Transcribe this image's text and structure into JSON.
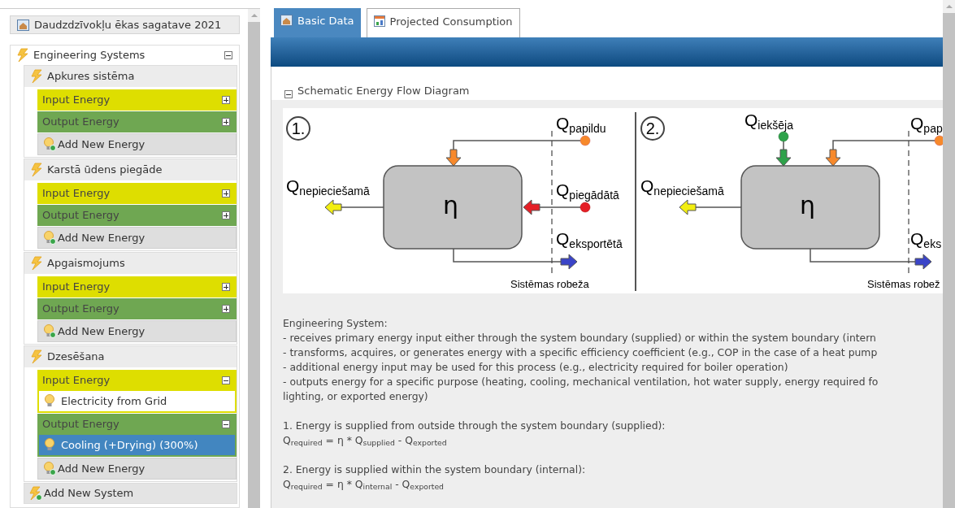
{
  "sidebar": {
    "project_button": "Daudzdzīvokļu ēkas sagatave 2021",
    "group": {
      "title": "Engineering Systems",
      "expanded": true,
      "systems": [
        {
          "name": "Apkures sistēma",
          "sections": [
            {
              "kind": "input",
              "label": "Input Energy",
              "expanded": false
            },
            {
              "kind": "output",
              "label": "Output Energy",
              "expanded": false
            }
          ],
          "add_label": "Add New Energy"
        },
        {
          "name": "Karstā ūdens piegāde",
          "sections": [
            {
              "kind": "input",
              "label": "Input Energy",
              "expanded": false
            },
            {
              "kind": "output",
              "label": "Output Energy",
              "expanded": false
            }
          ],
          "add_label": "Add New Energy"
        },
        {
          "name": "Apgaismojums",
          "sections": [
            {
              "kind": "input",
              "label": "Input Energy",
              "expanded": false
            },
            {
              "kind": "output",
              "label": "Output Energy",
              "expanded": false
            }
          ],
          "add_label": "Add New Energy"
        },
        {
          "name": "Dzesēšana",
          "sections": [
            {
              "kind": "input",
              "label": "Input Energy",
              "expanded": true,
              "items": [
                {
                  "label": "Electricity from Grid",
                  "selected": false
                }
              ]
            },
            {
              "kind": "output",
              "label": "Output Energy",
              "expanded": true,
              "items": [
                {
                  "label": "Cooling (+Drying) (300%)",
                  "selected": true
                }
              ]
            }
          ],
          "add_label": "Add New Energy"
        }
      ],
      "add_system": "Add New System"
    }
  },
  "tabs": [
    {
      "label": "Basic Data",
      "selected": true
    },
    {
      "label": "Projected Consumption",
      "selected": false
    }
  ],
  "section": {
    "title": "Schematic Energy Flow Diagram",
    "expanded": true
  },
  "diagram": {
    "panels": [
      {
        "number": "1.",
        "eta": "η",
        "labels": [
          {
            "kind": "additional",
            "text": "Q$_{papildu}$"
          },
          {
            "kind": "required",
            "text": "Q$_{nepieciešamā}$"
          },
          {
            "kind": "supplied",
            "text": "Q$_{piegādātā}$"
          },
          {
            "kind": "exported",
            "text": "Q$_{eksportētā}$"
          },
          {
            "kind": "boundary",
            "text": "Sistēmas robeža"
          }
        ]
      },
      {
        "number": "2.",
        "eta": "η",
        "labels": [
          {
            "kind": "internal",
            "text": "Q$_{iekšēja}$"
          },
          {
            "kind": "additional",
            "text": "Q$_{pap}$"
          },
          {
            "kind": "required",
            "text": "Q$_{nepieciešamā}$"
          },
          {
            "kind": "exported",
            "text": "Q$_{eks}$"
          },
          {
            "kind": "boundary",
            "text": "Sistēmas robež"
          }
        ]
      }
    ]
  },
  "description": {
    "heading": "Engineering System:",
    "lines": [
      "- receives primary energy input either through the system boundary (supplied) or within the system boundary (intern",
      "- transforms, acquires, or generates energy with a specific efficiency coefficient (e.g., COP in the case of a heat pump",
      "- additional energy input may be used for this process (e.g., electricity required for boiler operation)",
      "- outputs energy for a specific purpose (heating, cooling, mechanical ventilation, hot water supply, energy required fo",
      "lighting, or exported energy)"
    ],
    "cases": [
      {
        "title": "1. Energy is supplied from outside through the system boundary (supplied):",
        "formula": "Q$_{required}$ = η * Q$_{supplied}$ - Q$_{exported}$"
      },
      {
        "title": "2. Energy is supplied within the system boundary (internal):",
        "formula": "Q$_{required}$ = η * Q$_{internal}$ - Q$_{exported}$"
      }
    ]
  }
}
